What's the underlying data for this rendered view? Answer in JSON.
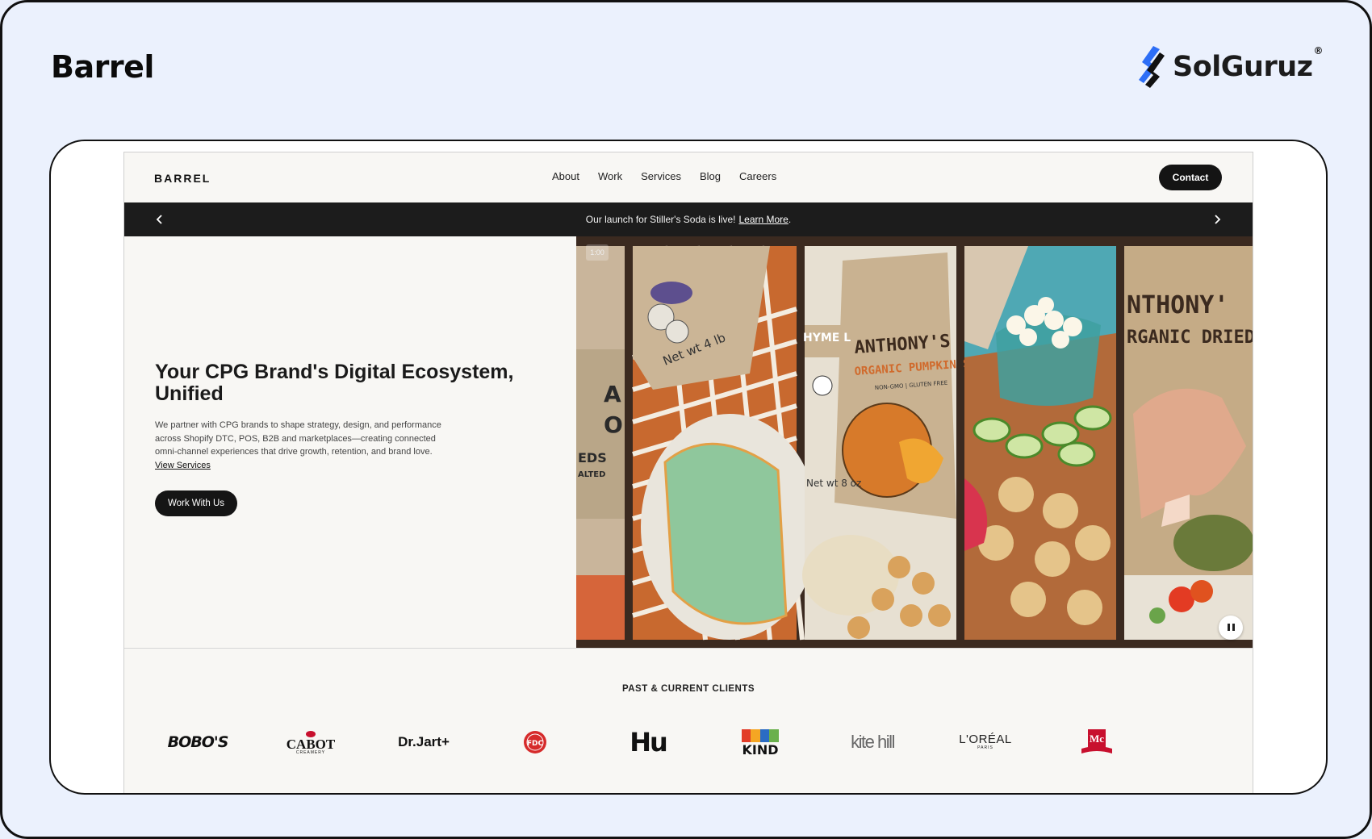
{
  "outer": {
    "brand_title": "Barrel",
    "partner_logo_text": "SolGuruz",
    "partner_logo_reg": "®"
  },
  "site": {
    "logo": "BARREL",
    "nav": [
      "About",
      "Work",
      "Services",
      "Blog",
      "Careers"
    ],
    "contact_label": "Contact",
    "announcement": {
      "text": "Our launch for Stiller's Soda is live!",
      "link": "Learn More",
      "suffix": "."
    },
    "hero": {
      "title_regular": "Your CPG Brand's Digital Ecosystem,",
      "title_bold": "Unified",
      "description": "We partner with CPG brands to shape strategy, design, and performance across Shopify DTC, POS, B2B and marketplaces—creating connected omni-channel experiences that drive growth, retention, and brand love.",
      "description_link": "View Services",
      "cta_label": "Work With Us"
    },
    "gallery": {
      "timer": "1:00",
      "panel_texts": [
        "Net wt 4 lb",
        "ANTHONY'S",
        "ORGANIC PUMPKIN S",
        "NON-GMO | GLUTEN FREE",
        "Net wt 8 oz",
        "NTHONY'",
        "RGANIC DRIED",
        "EDS",
        "ALTED"
      ]
    },
    "clients": {
      "title": "PAST & CURRENT CLIENTS",
      "logos": [
        "BOBO'S",
        "CABOT",
        "CREAMERY",
        "Dr.Jart+",
        "FDC",
        "Hu",
        "KIND",
        "kite hill",
        "L'ORÉAL",
        "PARIS",
        "Mc"
      ]
    }
  },
  "colors": {
    "page_bg": "#ebf1fd",
    "site_bg": "#f8f7f4",
    "dark": "#141414",
    "gallery_bg": "#3b2a20"
  }
}
